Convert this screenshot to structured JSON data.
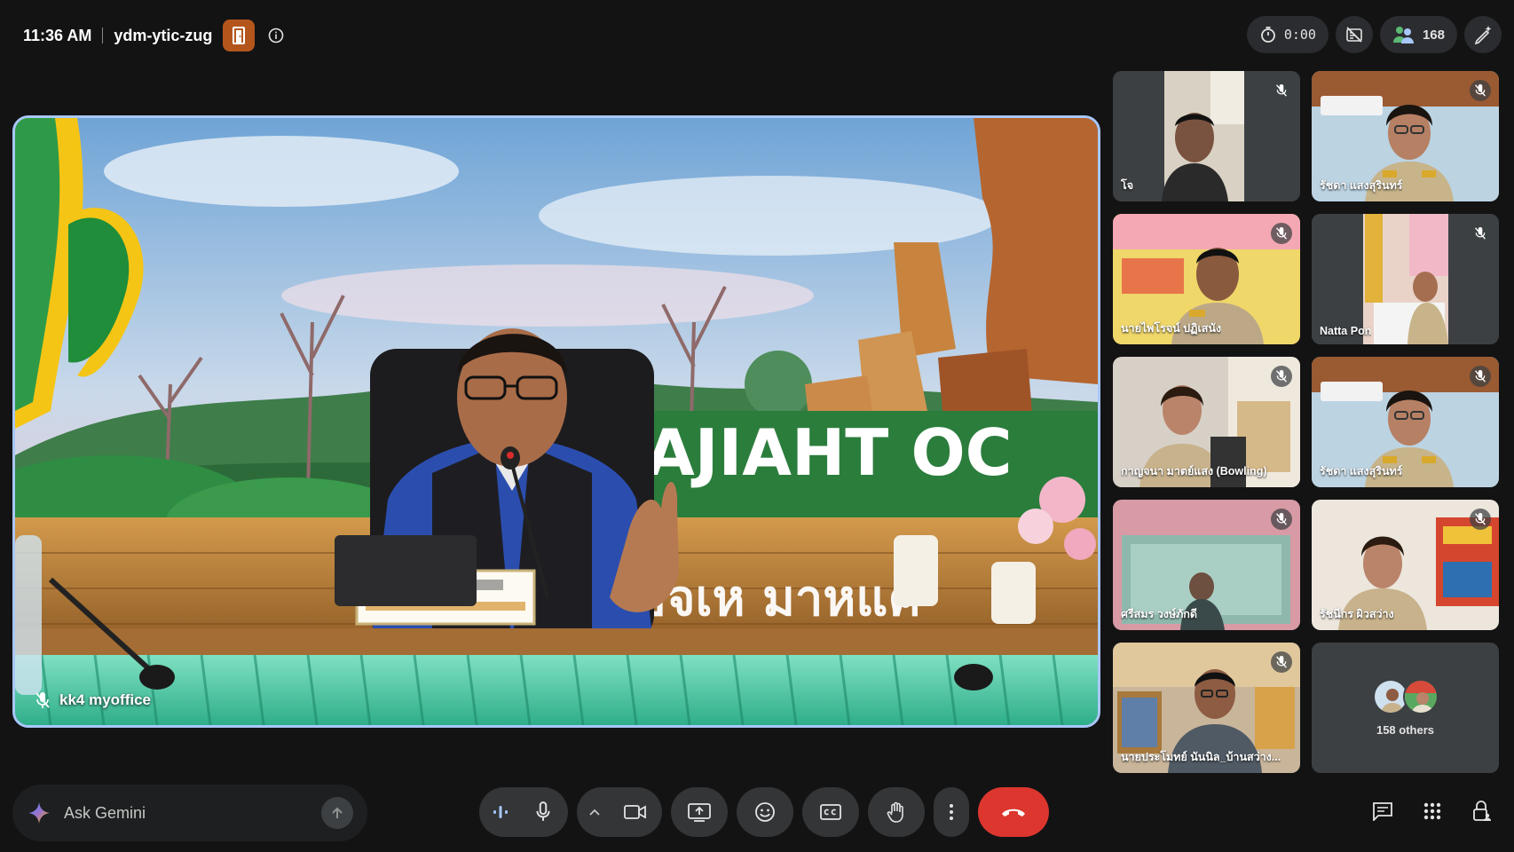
{
  "meeting": {
    "time": "11:36 AM",
    "code": "ydm-ytic-zug"
  },
  "status_bar": {
    "timer": "0:00",
    "participant_count": "168"
  },
  "main_speaker": {
    "name": "kk4 myoffice"
  },
  "participants": [
    {
      "name": "โจ",
      "muted": true
    },
    {
      "name": "รัชดา แสงสุรินทร์",
      "muted": true
    },
    {
      "name": "นายไพโรจน์ ปฏิเสนัง",
      "muted": true
    },
    {
      "name": "Natta Pon",
      "muted": true
    },
    {
      "name": "กาญจนา มาตย์แสง (Bowling)",
      "muted": true
    },
    {
      "name": "รัชดา แสงสุรินทร์",
      "muted": true
    },
    {
      "name": "ศรีสมร วงษ์ภักดี",
      "muted": true
    },
    {
      "name": "รัชนีกร ผิวสว่าง",
      "muted": true
    },
    {
      "name": "นายประโมทย์ นันนิล_บ้านสว่าง...",
      "muted": true
    }
  ],
  "others": {
    "label": "158 others"
  },
  "gemini": {
    "placeholder": "Ask Gemini"
  },
  "colors": {
    "background": "#131314",
    "active_speaker_border": "#a8c7fa",
    "end_call": "#dc362e",
    "host_badge": "#b4561c",
    "control_bg": "#333537"
  },
  "icons": {
    "host": "door-icon",
    "info": "info-icon",
    "timer": "timer-icon",
    "no_recording": "recording-off-icon",
    "people": "people-icon",
    "edit": "edit-sparkle-icon",
    "mic_off": "mic-off-icon",
    "audio_level": "audio-level-icon",
    "mic": "mic-icon",
    "camera": "camera-icon",
    "present": "present-screen-icon",
    "emoji": "emoji-icon",
    "captions": "captions-icon",
    "hand": "raise-hand-icon",
    "more": "more-vert-icon",
    "end_call": "end-call-icon",
    "chat": "chat-icon",
    "activities": "apps-grid-icon",
    "host_controls": "lock-person-icon"
  }
}
